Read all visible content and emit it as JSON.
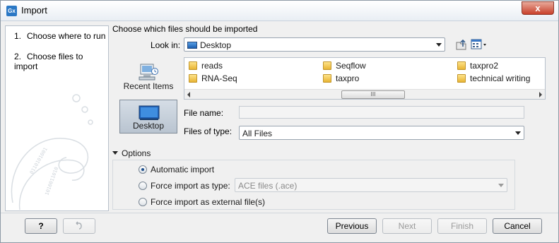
{
  "window": {
    "title": "Import",
    "app_icon_text": "Gx",
    "close_label": "x"
  },
  "steps": [
    {
      "num": "1.",
      "label": "Choose where to run"
    },
    {
      "num": "2.",
      "label": "Choose files to import"
    }
  ],
  "chooser": {
    "heading": "Choose which files should be imported",
    "look_in_label": "Look in:",
    "look_in_value": "Desktop",
    "places": [
      {
        "label": "Recent Items",
        "selected": false
      },
      {
        "label": "Desktop",
        "selected": true
      }
    ],
    "files": [
      "reads",
      "Seqflow",
      "taxpro2",
      "RNA-Seq",
      "taxpro",
      "technical writing"
    ],
    "file_name_label": "File name:",
    "file_name_value": "",
    "files_of_type_label": "Files of type:",
    "files_of_type_value": "All Files",
    "scroll_thumb_grip": "III"
  },
  "options": {
    "label": "Options",
    "radios": [
      {
        "label": "Automatic import",
        "checked": true
      },
      {
        "label": "Force import as type:",
        "checked": false
      },
      {
        "label": "Force import as external file(s)",
        "checked": false
      }
    ],
    "type_select_value": "ACE files (.ace)"
  },
  "footer": {
    "help_label": "?",
    "previous_label": "Previous",
    "next_label": "Next",
    "finish_label": "Finish",
    "cancel_label": "Cancel"
  }
}
